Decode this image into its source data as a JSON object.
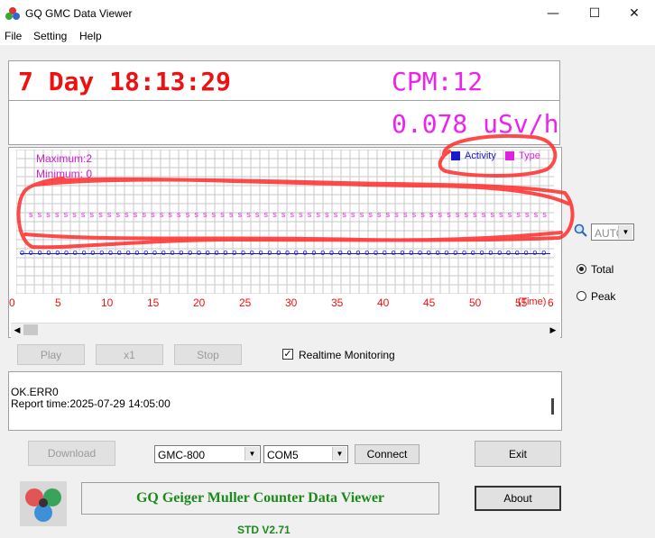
{
  "window": {
    "title": "GQ GMC Data Viewer",
    "min": "—",
    "max": "☐",
    "close": "✕"
  },
  "menu": [
    "File",
    "Setting",
    "Help"
  ],
  "display": {
    "uptime": "7 Day 18:13:29",
    "cpm": "CPM:12",
    "dose": "0.078 uSv/h"
  },
  "graph": {
    "maximum": "Maximum:2",
    "minimum": "Minimum: 0",
    "legend": [
      {
        "label": "Activity",
        "color": "#1a1acc"
      },
      {
        "label": "Type",
        "color": "#e020e0"
      }
    ],
    "x_ticks": [
      "0",
      "5",
      "10",
      "15",
      "20",
      "25",
      "30",
      "35",
      "40",
      "45",
      "50",
      "55"
    ],
    "x_unit": "(Time)",
    "x_last": "6",
    "marker_s_count": 60,
    "marker_o_count": 60
  },
  "zoom": {
    "select_value": "AUTO",
    "icon": "magnifier-icon"
  },
  "radio": {
    "total": "Total",
    "peak": "Peak",
    "selected": "Total"
  },
  "playback": {
    "play": "Play",
    "speed": "x1",
    "stop": "Stop"
  },
  "realtime": {
    "label": "Realtime Monitoring",
    "checked": true
  },
  "log": {
    "lines": [
      "OK.ERR0",
      "Report time:2025-07-29 14:05:00"
    ]
  },
  "controls": {
    "download": "Download",
    "model": "GMC-800",
    "port": "COM5",
    "connect": "Connect",
    "exit": "Exit",
    "about": "About"
  },
  "banner": {
    "title": "GQ Geiger Muller Counter Data Viewer",
    "version": "STD V2.71"
  },
  "colors": {
    "red": "#ee1111",
    "magenta": "#ee22ee",
    "green": "#1b8a1b"
  }
}
